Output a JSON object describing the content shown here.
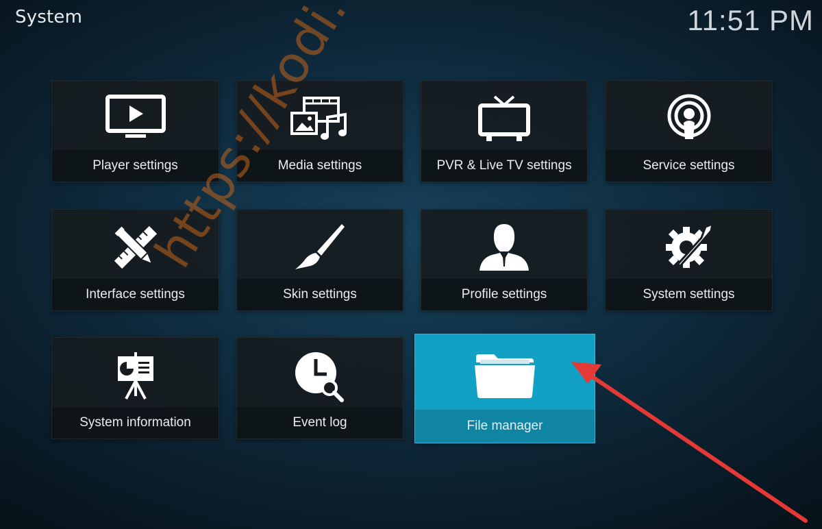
{
  "header": {
    "title": "System",
    "clock": "11:51 PM"
  },
  "tiles": [
    {
      "label": "Player settings",
      "icon": "monitor-play-icon"
    },
    {
      "label": "Media settings",
      "icon": "media-film-music-icon"
    },
    {
      "label": "PVR & Live TV settings",
      "icon": "tv-antenna-icon"
    },
    {
      "label": "Service settings",
      "icon": "broadcast-podcast-icon"
    },
    {
      "label": "Interface settings",
      "icon": "pencil-ruler-icon"
    },
    {
      "label": "Skin settings",
      "icon": "paintbrush-icon"
    },
    {
      "label": "Profile settings",
      "icon": "user-profile-icon"
    },
    {
      "label": "System settings",
      "icon": "gear-wrench-icon"
    },
    {
      "label": "System information",
      "icon": "presentation-easel-icon"
    },
    {
      "label": "Event log",
      "icon": "clock-search-icon"
    },
    {
      "label": "File manager",
      "icon": "folder-icon",
      "focused": true
    }
  ],
  "watermark": "https://kodi.expert",
  "colors": {
    "focus": "#12a0c4",
    "arrow": "#e53935",
    "watermark": "#c46419"
  }
}
